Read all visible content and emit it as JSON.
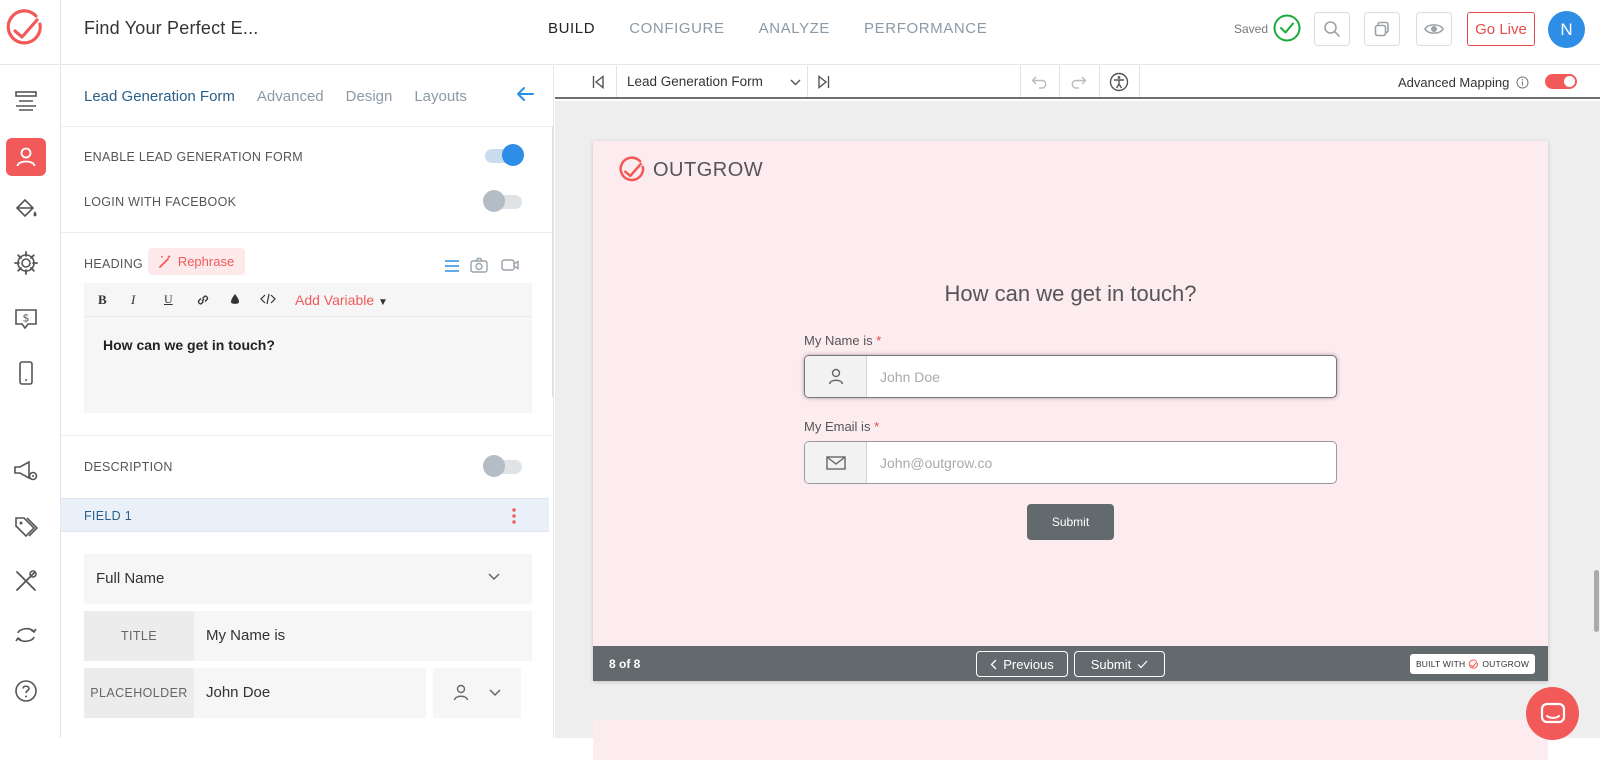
{
  "app": {
    "title": "Find Your Perfect E..."
  },
  "nav": {
    "build": "BUILD",
    "configure": "CONFIGURE",
    "analyze": "ANALYZE",
    "performance": "PERFORMANCE",
    "active": "BUILD"
  },
  "status": {
    "saved": "Saved"
  },
  "actions": {
    "go_live": "Go Live",
    "avatar_initial": "N"
  },
  "colors": {
    "brand": "#f25a5a",
    "accent_blue": "#2e8ee6",
    "saved_green": "#1aab3a",
    "footer_gray": "#636a6e",
    "card_bg": "#fdecef"
  },
  "rail_icons": [
    "layout-icon",
    "user-icon",
    "paint-bucket-icon",
    "gear-icon",
    "dollar-screen-icon",
    "mobile-icon",
    "megaphone-gear-icon",
    "tags-icon",
    "tools-icon",
    "sync-icon",
    "help-icon"
  ],
  "panel": {
    "tabs": [
      "Lead Generation Form",
      "Advanced",
      "Design",
      "Layouts"
    ],
    "active_tab": "Lead Generation Form",
    "enable_label": "ENABLE LEAD GENERATION FORM",
    "enable_on": true,
    "facebook_label": "LOGIN WITH FACEBOOK",
    "facebook_on": false,
    "heading_label": "HEADING",
    "rephrase_label": "Rephrase",
    "add_variable": "Add Variable",
    "heading_text": "How can we get in touch?",
    "description_label": "DESCRIPTION",
    "description_on": false,
    "field_title": "FIELD 1",
    "field_type": "Full Name",
    "title_key": "TITLE",
    "title_value": "My Name is",
    "placeholder_key": "PLACEHOLDER",
    "placeholder_value": "John Doe"
  },
  "canvas_toolbar": {
    "form_select": "Lead Generation Form",
    "advanced_mapping": "Advanced Mapping",
    "advanced_mapping_on": true
  },
  "preview": {
    "brand": "OUTGROW",
    "heading": "How can we get in touch?",
    "name_label": "My Name is",
    "name_placeholder": "John Doe",
    "email_label": "My Email is",
    "email_placeholder": "John@outgrow.co",
    "required_mark": "*",
    "submit": "Submit",
    "page_indicator": "8 of 8",
    "previous": "Previous",
    "footer_submit": "Submit",
    "built_with": "BUILT WITH",
    "built_brand": "OUTGROW"
  }
}
